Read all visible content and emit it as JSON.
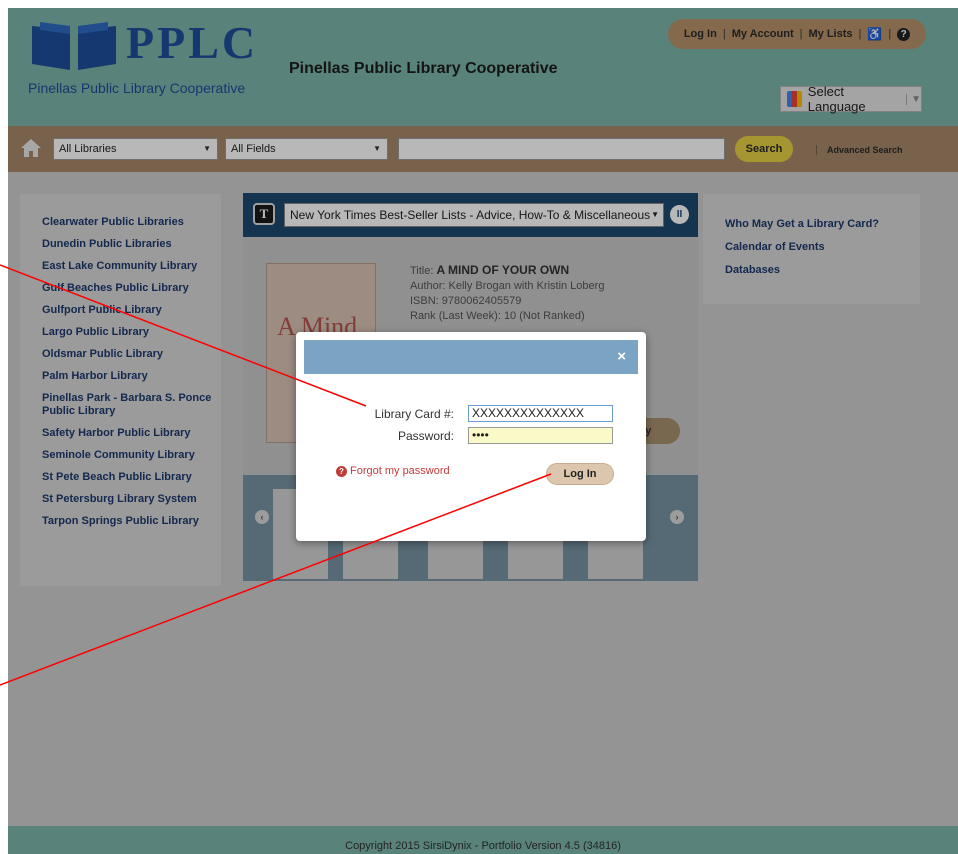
{
  "header": {
    "logo_text": "PPLC",
    "logo_subtitle": "Pinellas Public Library Cooperative",
    "site_title": "Pinellas Public Library Cooperative",
    "user_links": [
      "Log In",
      "My Account",
      "My Lists"
    ],
    "language_label": "Select Language"
  },
  "search": {
    "library_select": "All Libraries",
    "field_select": "All Fields",
    "query": "",
    "search_label": "Search",
    "advanced_label": "Advanced Search"
  },
  "left_nav": [
    "Clearwater Public Libraries",
    "Dunedin Public Libraries",
    "East Lake Community Library",
    "Gulf Beaches Public Library",
    "Gulfport Public Library",
    "Largo Public Library",
    "Oldsmar Public Library",
    "Palm Harbor Library",
    "Pinellas Park - Barbara S. Ponce Public Library",
    "Safety Harbor Public Library",
    "Seminole Community Library",
    "St Pete Beach Public Library",
    "St Petersburg Library System",
    "Tarpon Springs Public Library"
  ],
  "right_nav": [
    "Who May Get a Library Card?",
    "Calendar of Events",
    "Databases"
  ],
  "carousel": {
    "list_name": "New York Times Best-Seller Lists - Advice, How-To & Miscellaneous",
    "book": {
      "cover_text": "A Mind",
      "title_prefix": "Title:",
      "title": "A MIND OF YOUR OWN",
      "author": "Author: Kelly Brogan with Kristin Loberg",
      "isbn": "ISBN: 9780062405579",
      "rank": "Rank (Last Week): 10 (Not Ranked)"
    },
    "lib_button": "ry"
  },
  "modal": {
    "card_label": "Library Card #:",
    "card_value": "XXXXXXXXXXXXXX",
    "password_label": "Password:",
    "password_value": "••••",
    "forgot_label": "Forgot my password",
    "login_label": "Log In",
    "close_glyph": "×"
  },
  "footer": {
    "text": "Copyright 2015 SirsiDynix - Portfolio Version 4.5 (34816)"
  },
  "colors": {
    "header": "#7ab5a9",
    "searchbar": "#a8886a",
    "modal_header": "#7ba3c4",
    "annotation": "#ff0000"
  }
}
